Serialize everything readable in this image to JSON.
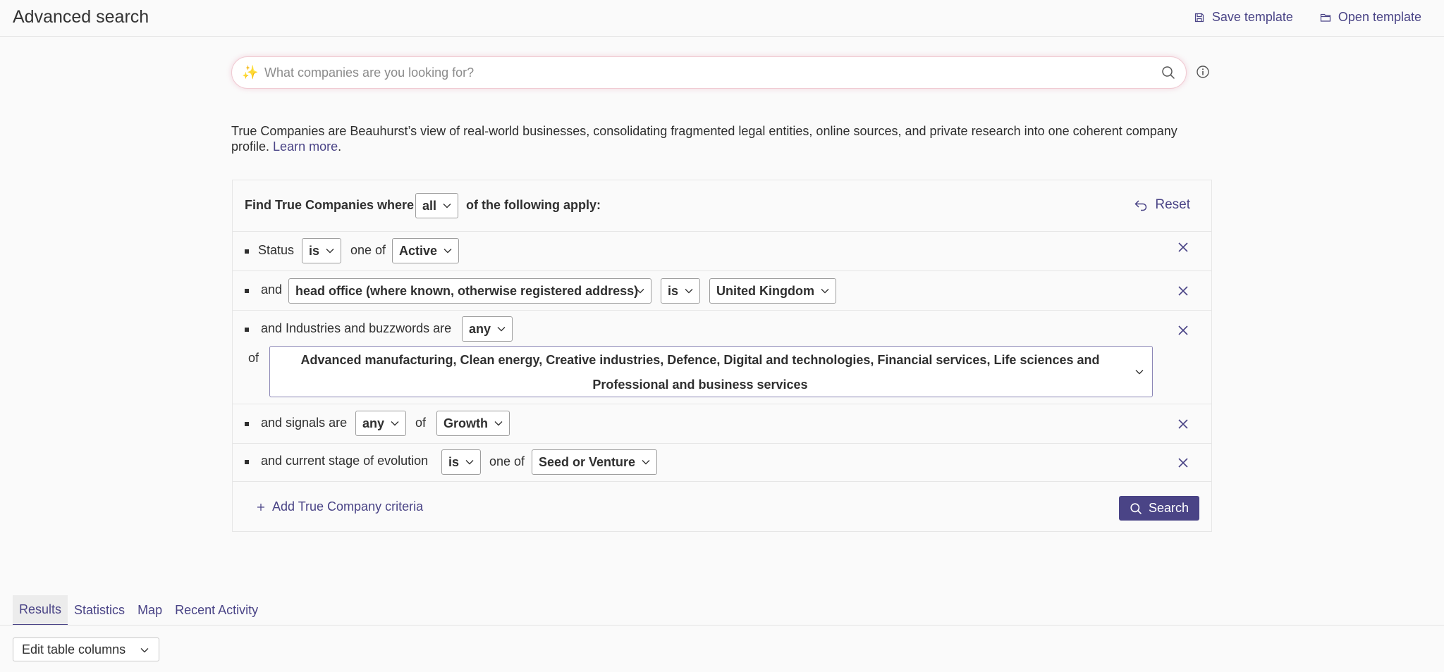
{
  "header": {
    "title": "Advanced search",
    "save_template": "Save template",
    "open_template": "Open template"
  },
  "search": {
    "placeholder": "What companies are you looking for?",
    "value": ""
  },
  "description": {
    "text": "True Companies are Beauhurst’s view of real-world businesses, consolidating fragmented legal entities, online sources, and private research into one coherent company profile.",
    "link": "Learn more",
    "suffix": "."
  },
  "builder": {
    "prefix": "Find True Companies where",
    "match_mode": "all",
    "suffix": "of the following apply:",
    "reset": "Reset",
    "criteria": [
      {
        "lead": "Status",
        "operator": "is",
        "joiner": "one of",
        "value": "Active"
      },
      {
        "lead": "and",
        "field": "head office (where known, otherwise registered address)",
        "operator": "is",
        "value": "United Kingdom"
      },
      {
        "lead": "and Industries and buzzwords are",
        "operator": "any",
        "joiner": "of",
        "value": "Advanced manufacturing, Clean energy, Creative industries, Defence, Digital and technologies, Financial services, Life sciences and Professional and business services"
      },
      {
        "lead": "and signals are",
        "operator": "any",
        "joiner": "of",
        "value": "Growth"
      },
      {
        "lead": "and current stage of evolution",
        "operator": "is",
        "joiner": "one of",
        "value": "Seed or Venture"
      }
    ],
    "add_criteria": "Add True Company criteria",
    "search_button": "Search"
  },
  "tabs": [
    {
      "label": "Results",
      "active": true
    },
    {
      "label": "Statistics",
      "active": false
    },
    {
      "label": "Map",
      "active": false
    },
    {
      "label": "Recent Activity",
      "active": false
    }
  ],
  "edit_columns": "Edit table columns",
  "colors": {
    "accent": "#4a4486",
    "border": "#e6e6e6"
  },
  "icons": [
    "save-icon",
    "folder-icon",
    "sparkle-icon",
    "search-icon",
    "info-icon",
    "reset-icon",
    "close-icon",
    "plus-icon",
    "chevron-down-icon"
  ]
}
